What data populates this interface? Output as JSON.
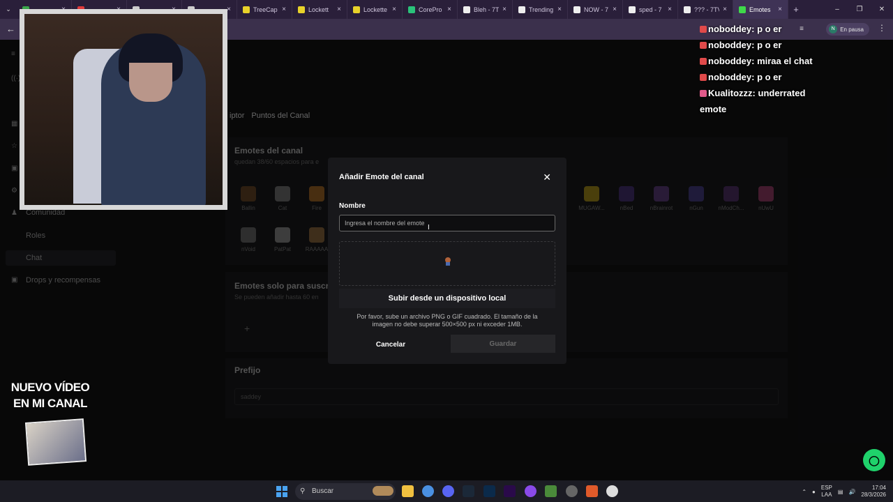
{
  "tabs": [
    {
      "label": "",
      "color": "#3aa64a"
    },
    {
      "label": "",
      "color": "#e03a3a"
    },
    {
      "label": "",
      "color": "#cccccc"
    },
    {
      "label": "",
      "color": "#cccccc"
    },
    {
      "label": "TreeCap",
      "color": "#e8d22a"
    },
    {
      "label": "Lockett",
      "color": "#e8d22a"
    },
    {
      "label": "Lockette",
      "color": "#e8d22a"
    },
    {
      "label": "CorePro",
      "color": "#2ac27a"
    },
    {
      "label": "Bleh - 7T",
      "color": "#eeeeee"
    },
    {
      "label": "Trending",
      "color": "#eeeeee"
    },
    {
      "label": "NOW - 7",
      "color": "#eeeeee"
    },
    {
      "label": "sped - 7",
      "color": "#eeeeee"
    },
    {
      "label": "??? - 7TV",
      "color": "#eeeeee"
    },
    {
      "label": "Emotes",
      "color": "#3fd94a",
      "active": true
    }
  ],
  "browser": {
    "pause_label": "En pausa",
    "pause_avatar": "N"
  },
  "sidebar": {
    "items": [
      {
        "label": "Comunidad"
      },
      {
        "label": "Roles"
      },
      {
        "label": "Chat"
      },
      {
        "label": "Drops y recompensas"
      }
    ]
  },
  "subtabs": [
    "iptor",
    "Puntos del Canal"
  ],
  "channel_emotes": {
    "title": "Emotes del canal",
    "subtitle": "quedan 38/60 espacios para e",
    "emotes": [
      {
        "name": "Ballin",
        "color": "#8a5a2a"
      },
      {
        "name": "Cat",
        "color": "#999999"
      },
      {
        "name": "Fire",
        "color": "#e08a2a"
      },
      {
        "name": "MUGAW...",
        "color": "#e8c21a"
      },
      {
        "name": "nBed",
        "color": "#5a3a9a"
      },
      {
        "name": "nBrainrot",
        "color": "#7a4aa8"
      },
      {
        "name": "nGun",
        "color": "#5a4ab0"
      },
      {
        "name": "nModCh...",
        "color": "#6a3a8a"
      },
      {
        "name": "nUwU",
        "color": "#d04a8a"
      },
      {
        "name": "nVoid",
        "color": "#888888"
      },
      {
        "name": "PatPat",
        "color": "#bbbbbb"
      },
      {
        "name": "RAAAAA",
        "color": "#c08a4a"
      }
    ]
  },
  "sub_emotes": {
    "title": "Emotes solo para suscr",
    "subtitle": "Se pueden añadir hasta 60 en"
  },
  "prefix": {
    "title": "Prefijo",
    "value": "saddey"
  },
  "modal": {
    "title": "Añadir Emote del canal",
    "name_label": "Nombre",
    "name_placeholder": "Ingresa el nombre del emote",
    "upload_label": "Subir desde un dispositivo local",
    "hint": "Por favor, sube un archivo PNG o GIF cuadrado. El tamaño de la imagen no debe superar 500×500 px ni exceder 1MB.",
    "cancel_label": "Cancelar",
    "save_label": "Guardar"
  },
  "chat": [
    {
      "badge": "#e04a4a",
      "user": "noboddey:",
      "text": "p o er"
    },
    {
      "badge": "#e04a4a",
      "user": "noboddey:",
      "text": "p o er"
    },
    {
      "badge": "#e04a4a",
      "user": "noboddey:",
      "text": "miraa el chat"
    },
    {
      "badge": "#e04a4a",
      "user": "noboddey:",
      "text": "p o er"
    },
    {
      "badge": "#e05a8a",
      "user": "Kualitozzz:",
      "text": "underrated"
    },
    {
      "badge": "",
      "user": "",
      "text": "emote"
    }
  ],
  "overlay": {
    "promo_line1": "NUEVO VÍDEO",
    "promo_line2": "EN MI CANAL"
  },
  "taskbar": {
    "search_label": "Buscar",
    "lang_top": "ESP",
    "lang_bottom": "LAA",
    "time": "17:04",
    "date": "28/3/2026"
  }
}
